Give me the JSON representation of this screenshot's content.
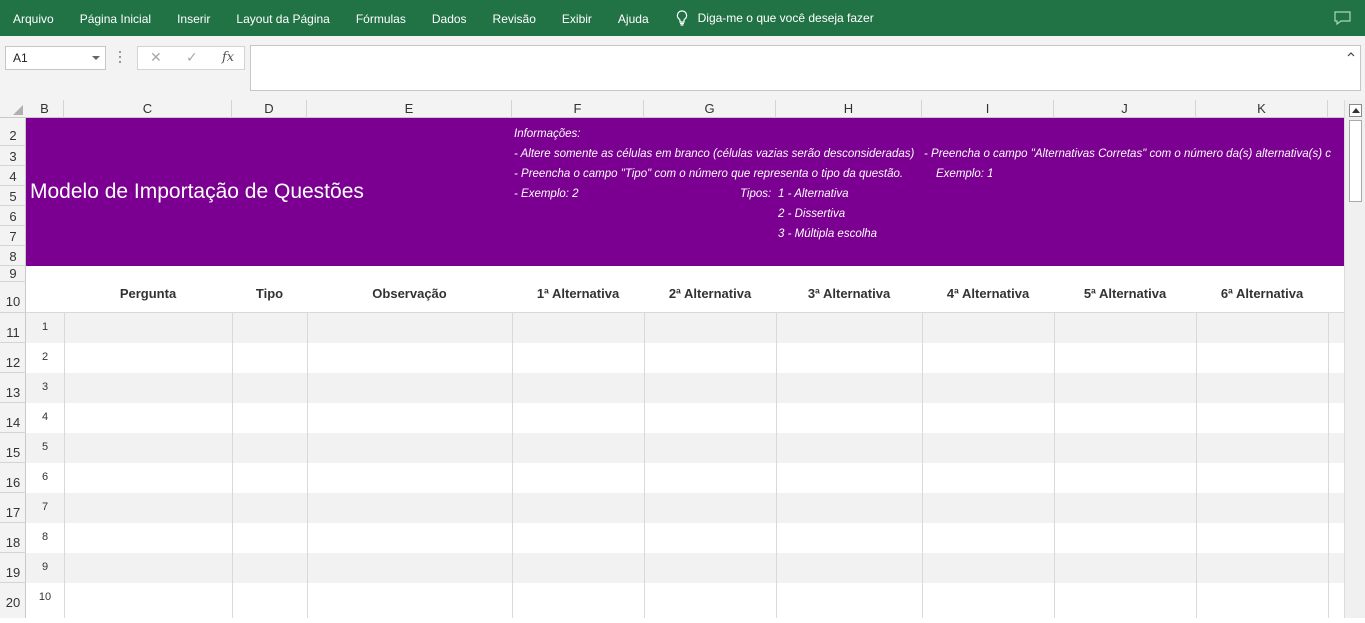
{
  "ribbon": {
    "tabs": [
      "Arquivo",
      "Página Inicial",
      "Inserir",
      "Layout da Página",
      "Fórmulas",
      "Dados",
      "Revisão",
      "Exibir",
      "Ajuda"
    ],
    "tell_me": "Diga-me o que você deseja fazer"
  },
  "formula_bar": {
    "name_box": "A1",
    "fx_label": "fx",
    "formula_value": ""
  },
  "columns": [
    "B",
    "C",
    "D",
    "E",
    "F",
    "G",
    "H",
    "I",
    "J",
    "K"
  ],
  "row_numbers": [
    "2",
    "3",
    "4",
    "5",
    "6",
    "7",
    "8",
    "9",
    "10",
    "11",
    "12",
    "13",
    "14",
    "15",
    "16",
    "17",
    "18",
    "19",
    "20"
  ],
  "banner": {
    "title": "Modelo de Importação de Questões",
    "info_heading": "Informações:",
    "info_line1": "- Altere somente as células em branco (células vazias serão desconsideradas)",
    "info_line1b": "- Preencha o campo \"Alternativas Corretas\" com o número da(s) alternativa(s) c",
    "info_line2": "- Preencha o campo \"Tipo\" com o número que representa o tipo da questão.",
    "info_line2b": "Exemplo: 1",
    "info_line3": "- Exemplo: 2",
    "tipos_label": "Tipos:",
    "tipo1": "1 - Alternativa",
    "tipo2": "2 - Dissertiva",
    "tipo3": "3 - Múltipla escolha"
  },
  "table_headers": [
    "Pergunta",
    "Tipo",
    "Observação",
    "1ª Alternativa",
    "2ª Alternativa",
    "3ª Alternativa",
    "4ª Alternativa",
    "5ª Alternativa",
    "6ª Alternativa"
  ],
  "question_numbers": [
    "1",
    "2",
    "3",
    "4",
    "5",
    "6",
    "7",
    "8",
    "9",
    "10"
  ],
  "colors": {
    "ribbon": "#217346",
    "banner": "#7b0091"
  }
}
